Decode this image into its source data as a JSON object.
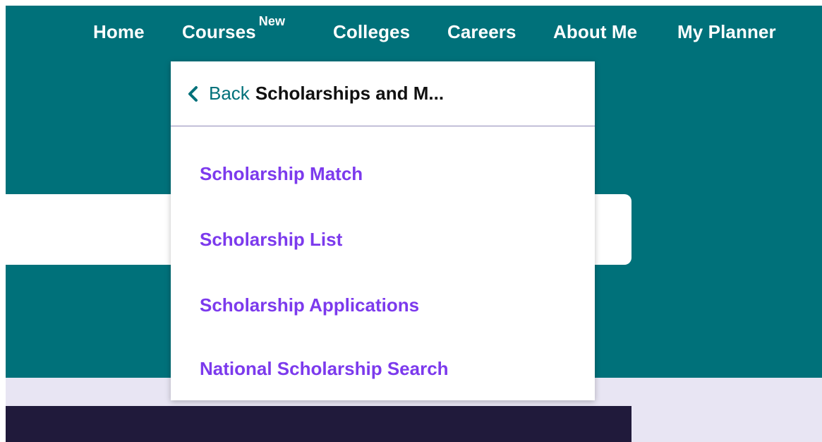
{
  "nav": {
    "home": "Home",
    "courses": "Courses",
    "courses_badge": "New",
    "colleges": "Colleges",
    "careers": "Careers",
    "about_me": "About Me",
    "my_planner": "My Planner"
  },
  "dropdown": {
    "back_label": "Back",
    "title": "Scholarships and M...",
    "items": [
      {
        "label": "Scholarship Match"
      },
      {
        "label": "Scholarship List"
      },
      {
        "label": "Scholarship Applications"
      },
      {
        "label": "National Scholarship Search"
      }
    ]
  },
  "colors": {
    "header_bg": "#00717a",
    "link": "#7c3aed",
    "lavender": "#e8e5f3",
    "dark_panel": "#201a3b"
  },
  "icons": {
    "back": "chevron-left-icon"
  }
}
